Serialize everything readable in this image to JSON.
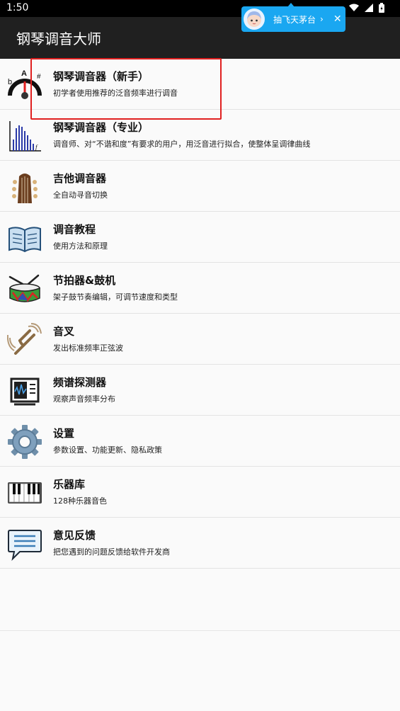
{
  "status_bar": {
    "time": "1:50"
  },
  "app_bar": {
    "title": "钢琴调音大师"
  },
  "ad": {
    "text": "抽飞天茅台",
    "chevron": "›",
    "close": "✕"
  },
  "menu": [
    {
      "title": "钢琴调音器（新手）",
      "desc": "初学者使用推荐的泛音频率进行调音",
      "icon": "tuner-gauge-icon"
    },
    {
      "title": "钢琴调音器（专业）",
      "desc": "调音师、对“不谐和度”有要求的用户，用泛音进行拟合，使整体呈调律曲线",
      "icon": "spectrum-bars-icon"
    },
    {
      "title": "吉他调音器",
      "desc": "全自动寻音切换",
      "icon": "guitar-head-icon"
    },
    {
      "title": "调音教程",
      "desc": "使用方法和原理",
      "icon": "book-icon"
    },
    {
      "title": "节拍器&鼓机",
      "desc": "架子鼓节奏编辑，可调节速度和类型",
      "icon": "drum-icon"
    },
    {
      "title": "音叉",
      "desc": "发出标准频率正弦波",
      "icon": "tuning-fork-icon"
    },
    {
      "title": "频谱探测器",
      "desc": "观察声音频率分布",
      "icon": "spectrum-monitor-icon"
    },
    {
      "title": "设置",
      "desc": "参数设置、功能更新、隐私政策",
      "icon": "gear-icon"
    },
    {
      "title": "乐器库",
      "desc": "128种乐器音色",
      "icon": "piano-keys-icon"
    },
    {
      "title": "意见反馈",
      "desc": "把您遇到的问题反馈给软件开发商",
      "icon": "message-icon"
    }
  ]
}
